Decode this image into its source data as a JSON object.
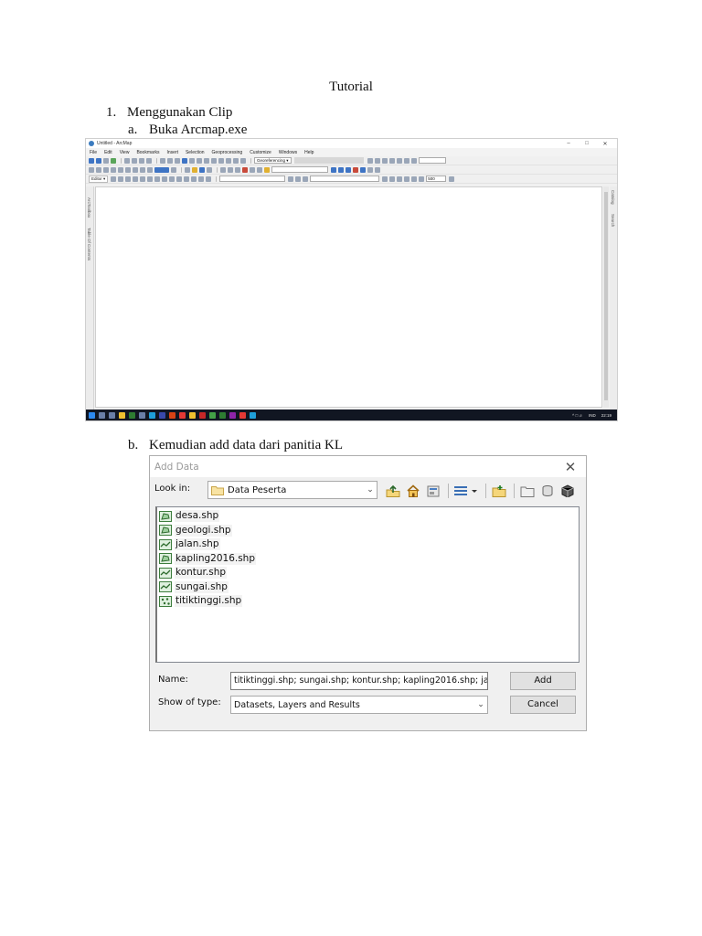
{
  "document": {
    "title": "Tutorial",
    "step1_num": "1.",
    "step1": "Menggunakan Clip",
    "step1a_letter": "a.",
    "step1a": "Buka Arcmap.exe",
    "step1b_letter": "b.",
    "step1b": "Kemudian add data dari panitia KL"
  },
  "arcmap": {
    "window_title": "Untitled - ArcMap",
    "menu": [
      "File",
      "Edit",
      "View",
      "Bookmarks",
      "Insert",
      "Selection",
      "Geoprocessing",
      "Customize",
      "Windows",
      "Help"
    ],
    "georef_label": "Georeferencing ▾",
    "editor_label": "Editor ▾",
    "scale_value": "500",
    "left_panel_1": "ArcToolbox",
    "left_panel_2": "Table Of Contents",
    "right_panel_1": "Catalog",
    "right_panel_2": "Search",
    "taskbar_lang": "IND",
    "taskbar_time": "22:19"
  },
  "dialog": {
    "title": "Add Data",
    "close_glyph": "✕",
    "look_in_label": "Look in:",
    "look_in_value": "Data Peserta",
    "files": [
      {
        "name": "desa.shp",
        "icon": "polygon-layer-icon"
      },
      {
        "name": "geologi.shp",
        "icon": "polygon-layer-icon"
      },
      {
        "name": "jalan.shp",
        "icon": "line-layer-icon"
      },
      {
        "name": "kapling2016.shp",
        "icon": "polygon-layer-icon"
      },
      {
        "name": "kontur.shp",
        "icon": "line-layer-icon"
      },
      {
        "name": "sungai.shp",
        "icon": "line-layer-icon"
      },
      {
        "name": "titiktinggi.shp",
        "icon": "point-layer-icon"
      }
    ],
    "name_label": "Name:",
    "name_value": "titiktinggi.shp; sungai.shp; kontur.shp; kapling2016.shp; ja",
    "type_label": "Show of type:",
    "type_value": "Datasets, Layers and Results",
    "add_label": "Add",
    "cancel_label": "Cancel"
  }
}
